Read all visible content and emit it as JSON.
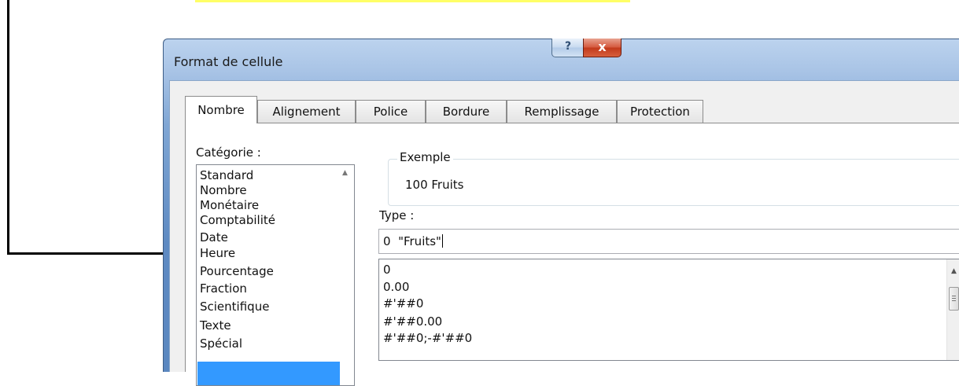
{
  "window": {
    "title": "Format de cellule",
    "help_label": "?",
    "close_label": "x"
  },
  "tabs": [
    "Nombre",
    "Alignement",
    "Police",
    "Bordure",
    "Remplissage",
    "Protection"
  ],
  "category": {
    "label": "Catégorie :",
    "items": [
      "Standard",
      "Nombre",
      "Monétaire",
      "Comptabilité",
      "Date",
      "Heure",
      "Pourcentage",
      "Fraction",
      "Scientifique",
      "Texte",
      "Spécial"
    ]
  },
  "example": {
    "label": "Exemple",
    "value": "100  Fruits"
  },
  "type": {
    "label": "Type :",
    "value": "0  \"Fruits\"",
    "formats": [
      "0",
      "0.00",
      "#'##0",
      "#'##0.00",
      "#'##0;-#'##0"
    ]
  },
  "colors": {
    "selection": "#3399ff",
    "highlight_strip": "#ffff66",
    "close_button": "#c23a1c"
  }
}
